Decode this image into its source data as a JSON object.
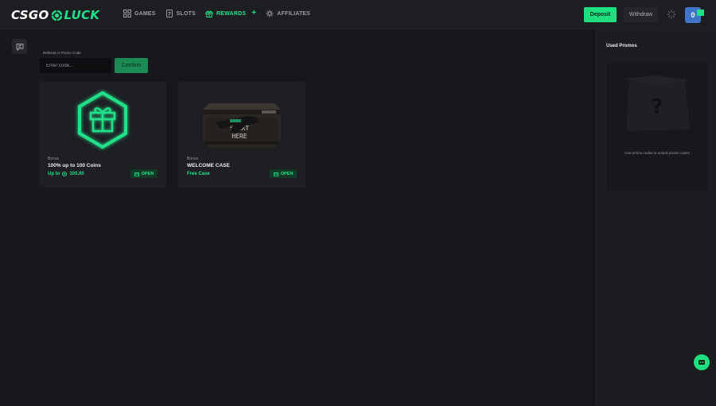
{
  "brand": {
    "part1": "CSGO",
    "part2": "LUCK",
    "accent": "#22e08a"
  },
  "nav": {
    "items": [
      {
        "label": "GAMES",
        "icon": "games-icon",
        "active": false
      },
      {
        "label": "SLOTS",
        "icon": "slots-icon",
        "active": false
      },
      {
        "label": "REWARDS",
        "icon": "gift-icon",
        "active": true
      },
      {
        "label": "AFFILIATES",
        "icon": "affiliates-icon",
        "active": false
      }
    ],
    "rewards_plus": "+"
  },
  "header": {
    "deposit_label": "Deposit",
    "withdraw_label": "Withdraw",
    "balance": "0"
  },
  "promo": {
    "label": "Referral or Promo Code",
    "placeholder": "Enter code...",
    "confirm_label": "Confirm"
  },
  "cards": [
    {
      "category": "Bonus",
      "title": "100% up to 100 Coins",
      "subtitle_prefix": "Up to",
      "subtitle_value": "100,00",
      "open_label": "OPEN",
      "art": "gift-hexagon-icon"
    },
    {
      "category": "Bonus",
      "title": "WELCOME CASE",
      "subtitle": "Free Case",
      "open_label": "OPEN",
      "art": "welcome-case-image",
      "case_text": [
        "START",
        "HERE"
      ]
    }
  ],
  "used_promos": {
    "title": "Used Promos",
    "empty_text": "Use promo codes to unlock promo cases",
    "placeholder_glyph": "?"
  },
  "colors": {
    "background": "#17181c",
    "panel": "#1e1f23",
    "accent": "#22e08a",
    "deposit": "#1ee081",
    "balance": "#3f76c9"
  }
}
